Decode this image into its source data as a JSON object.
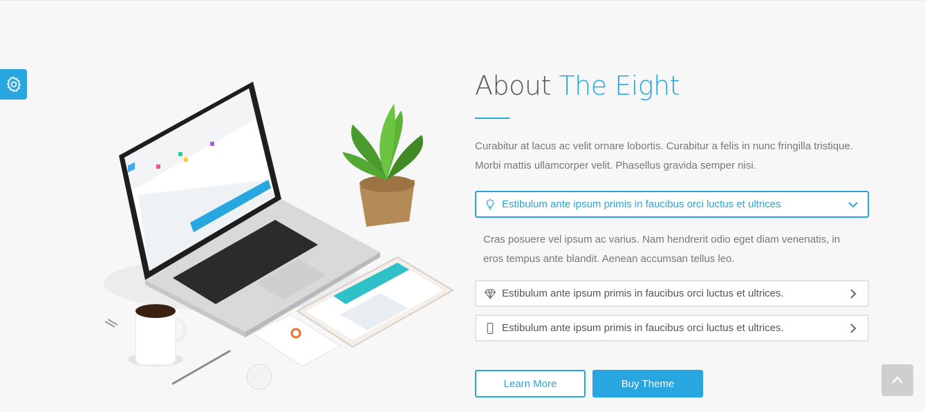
{
  "title": {
    "prefix": "About",
    "accent": "The Eight"
  },
  "intro": "Curabitur at lacus ac velit ornare lobortis. Curabitur a felis in nunc fringilla tristique. Morbi mattis ullamcorper velit. Phasellus gravida semper nisi.",
  "accordion": {
    "items": [
      {
        "label": "Estibulum ante ipsum primis in faucibus orci luctus et ultrices",
        "icon": "lightbulb-icon",
        "expanded": true
      },
      {
        "label": "Estibulum ante ipsum primis in faucibus orci luctus et ultrices.",
        "icon": "diamond-icon",
        "expanded": false
      },
      {
        "label": "Estibulum ante ipsum primis in faucibus orci luctus et ultrices.",
        "icon": "mobile-icon",
        "expanded": false
      }
    ],
    "expanded_body": "Cras posuere vel ipsum ac varius. Nam hendrerit odio eget diam venenatis, in eros tempus ante blandit. Aenean accumsan tellus leo."
  },
  "buttons": {
    "learn_more": "Learn More",
    "buy_theme": "Buy Theme"
  },
  "colors": {
    "accent": "#27a6e0",
    "background": "#f7f7f7",
    "text": "#777777",
    "heading": "#555555"
  },
  "icons": {
    "settings": "gear-icon",
    "to_top": "chevron-up-icon"
  }
}
